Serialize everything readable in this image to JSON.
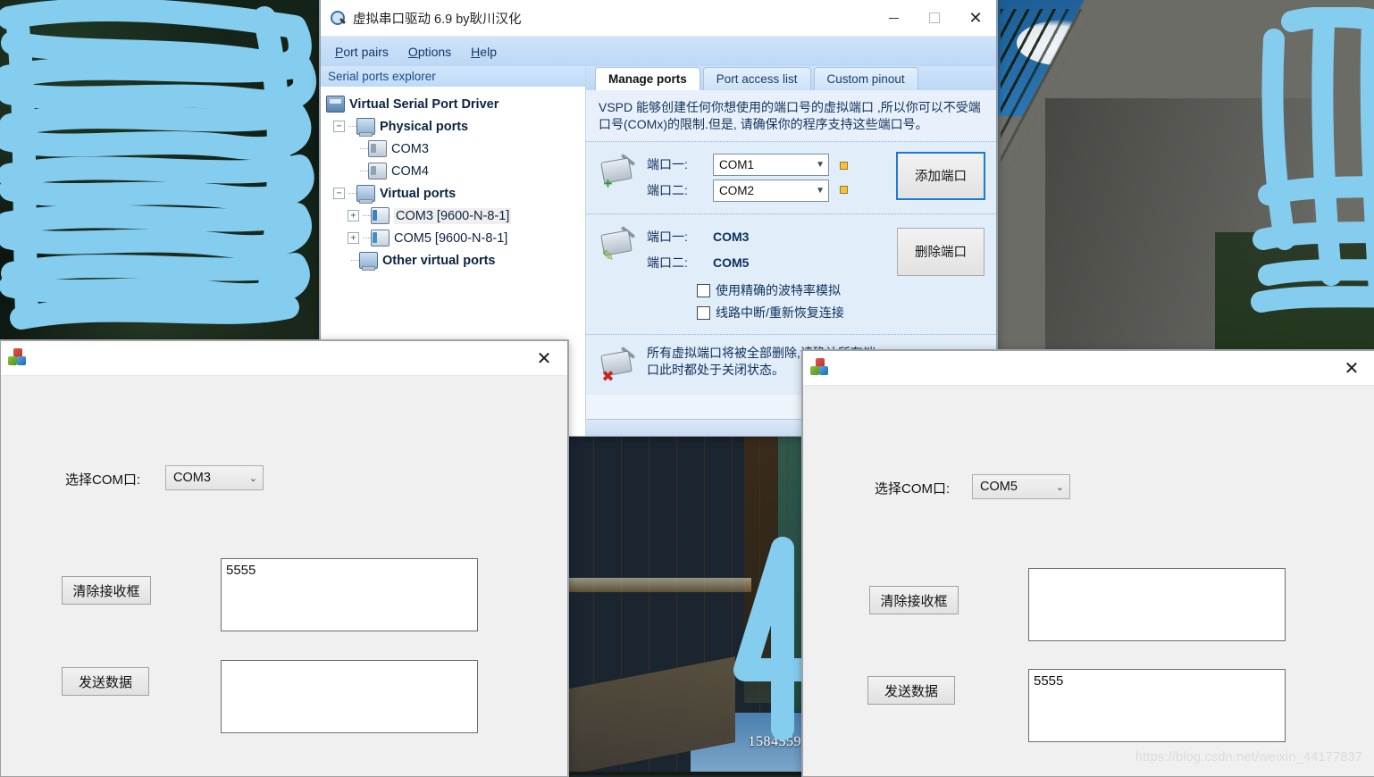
{
  "desktop": {
    "middle_photo_counter": "1584559"
  },
  "vspd": {
    "title": "虚拟串口驱动 6.9 by耿川汉化",
    "window_controls": {
      "minimize": "–",
      "maximize": "□",
      "close": "✕"
    },
    "menu": [
      {
        "label": "Port pairs",
        "accel": "P"
      },
      {
        "label": "Options",
        "accel": "O"
      },
      {
        "label": "Help",
        "accel": "H"
      }
    ],
    "sidebar": {
      "header": "Serial ports explorer",
      "tree": [
        {
          "label": "Virtual Serial Port Driver",
          "level": 0,
          "bold": true,
          "icon": "driver-icon",
          "expander": ""
        },
        {
          "label": "Physical ports",
          "level": 1,
          "bold": true,
          "icon": "computer-icon",
          "expander": "−"
        },
        {
          "label": "COM3",
          "level": 2,
          "bold": false,
          "icon": "port-icon",
          "expander": ""
        },
        {
          "label": "COM4",
          "level": 2,
          "bold": false,
          "icon": "port-icon",
          "expander": ""
        },
        {
          "label": "Virtual ports",
          "level": 1,
          "bold": true,
          "icon": "computer-icon",
          "expander": "−"
        },
        {
          "label": "COM3 [9600-N-8-1]",
          "level": 2,
          "bold": false,
          "icon": "virtual-port-icon",
          "expander": "+",
          "selected": true
        },
        {
          "label": "COM5 [9600-N-8-1]",
          "level": 2,
          "bold": false,
          "icon": "virtual-port-icon",
          "expander": "+"
        },
        {
          "label": "Other virtual ports",
          "level": 1,
          "bold": true,
          "icon": "computer-icon",
          "expander": ""
        }
      ]
    },
    "tabs": [
      {
        "label": "Manage ports",
        "active": true
      },
      {
        "label": "Port access list",
        "active": false
      },
      {
        "label": "Custom pinout",
        "active": false
      }
    ],
    "blurb": "VSPD 能够创建任何你想使用的端口号的虚拟端口 ,所以你可以不受端口号(COMx)的限制.但是, 请确保你的程序支持这些端口号。",
    "add_section": {
      "icon": "add-port-icon",
      "port1_label": "端口一:",
      "port1_value": "COM1",
      "port2_label": "端口二:",
      "port2_value": "COM2",
      "button": "添加端口"
    },
    "manage_section": {
      "icon": "edit-port-icon",
      "port1_label": "端口一:",
      "port1_value": "COM3",
      "port2_label": "端口二:",
      "port2_value": "COM5",
      "button": "删除端口",
      "checkbox1": "使用精确的波特率模拟",
      "checkbox1_checked": false,
      "checkbox2": "线路中断/重新恢复连接",
      "checkbox2_checked": false
    },
    "warn_section": {
      "icon": "delete-all-ports-icon",
      "text": "所有虚拟端口将被全部删除,请确认所有端口此时都处于关闭状态。"
    }
  },
  "terminal_left": {
    "titlebar_icon": "vs-app-icon",
    "close": "✕",
    "com_label": "选择COM口:",
    "com_value": "COM3",
    "clear_button": "清除接收框",
    "receive_text": "5555",
    "send_button": "发送数据",
    "send_text": ""
  },
  "terminal_right": {
    "titlebar_icon": "vs-app-icon",
    "close": "✕",
    "com_label": "选择COM口:",
    "com_value": "COM5",
    "clear_button": "清除接收框",
    "receive_text": "",
    "send_button": "发送数据",
    "send_text": "5555"
  },
  "watermark": "https://blog.csdn.net/weixin_44177837"
}
